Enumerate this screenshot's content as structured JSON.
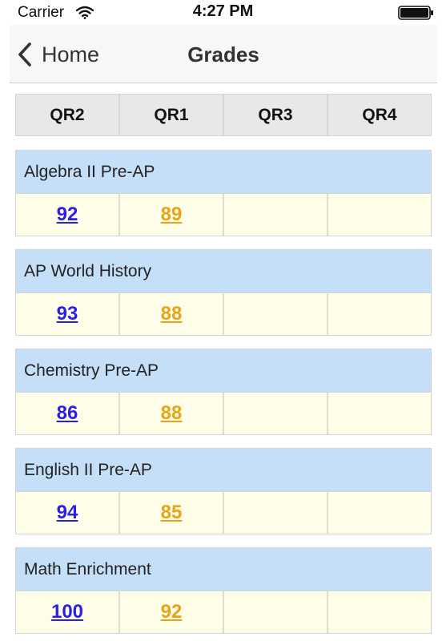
{
  "status_bar": {
    "carrier": "Carrier",
    "time": "4:27 PM",
    "icons": [
      "wifi-icon",
      "battery-icon"
    ]
  },
  "nav": {
    "back_label": "Home",
    "title": "Grades",
    "icons": [
      "back-chevron-icon"
    ]
  },
  "quarters": [
    "QR2",
    "QR1",
    "QR3",
    "QR4"
  ],
  "colors": {
    "course_header_bg": "#c5dff9",
    "grade_row_bg": "#fefde8",
    "qr2_grade": "#2a1ee8",
    "qr1_grade": "#e9a415"
  },
  "courses": [
    {
      "name": "Algebra II Pre-AP",
      "grades": [
        "92",
        "89",
        "",
        ""
      ]
    },
    {
      "name": "AP World History",
      "grades": [
        "93",
        "88",
        "",
        ""
      ]
    },
    {
      "name": "Chemistry Pre-AP",
      "grades": [
        "86",
        "88",
        "",
        ""
      ]
    },
    {
      "name": "English II Pre-AP",
      "grades": [
        "94",
        "85",
        "",
        ""
      ]
    },
    {
      "name": "Math Enrichment",
      "grades": [
        "100",
        "92",
        "",
        ""
      ]
    }
  ]
}
